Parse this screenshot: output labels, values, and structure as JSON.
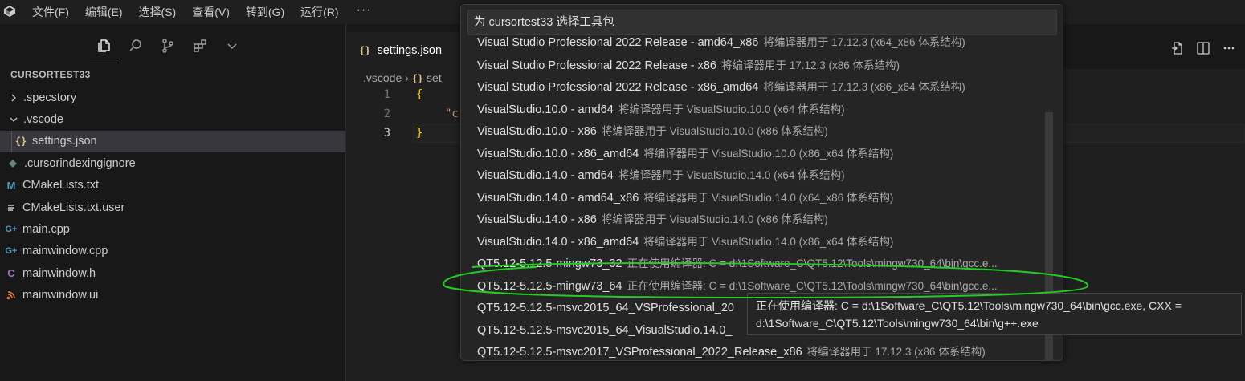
{
  "menu": {
    "items": [
      "文件(F)",
      "编辑(E)",
      "选择(S)",
      "查看(V)",
      "转到(G)",
      "运行(R)"
    ],
    "more": "···"
  },
  "sidebar": {
    "section_title": "CURSORTEST33",
    "items": [
      {
        "label": ".specstory",
        "type": "folder",
        "expanded": false
      },
      {
        "label": ".vscode",
        "type": "folder",
        "expanded": true
      },
      {
        "label": "settings.json",
        "type": "json",
        "icon_text": "{}",
        "selected": true
      },
      {
        "label": ".cursorindexingignore",
        "type": "file"
      },
      {
        "label": "CMakeLists.txt",
        "type": "cmake",
        "icon_text": "M"
      },
      {
        "label": "CMakeLists.txt.user",
        "type": "text"
      },
      {
        "label": "main.cpp",
        "type": "cpp",
        "icon_text": "G+"
      },
      {
        "label": "mainwindow.cpp",
        "type": "cpp",
        "icon_text": "G+"
      },
      {
        "label": "mainwindow.h",
        "type": "header",
        "icon_text": "C"
      },
      {
        "label": "mainwindow.ui",
        "type": "ui"
      }
    ]
  },
  "editor": {
    "tab_label": "settings.json",
    "tab_icon_text": "{}",
    "breadcrumb": {
      "folder": ".vscode",
      "sep": "›",
      "file": "set"
    },
    "lines": [
      {
        "num": "1",
        "text": "{"
      },
      {
        "num": "2",
        "text": "\"c"
      },
      {
        "num": "3",
        "text": "}"
      }
    ]
  },
  "quickpick": {
    "placeholder": "为 cursortest33 选择工具包",
    "items": [
      {
        "label": "Visual Studio Professional 2022 Release - amd64_x86",
        "desc": "将编译器用于 17.12.3 (x64_x86 体系结构)"
      },
      {
        "label": "Visual Studio Professional 2022 Release - x86",
        "desc": "将编译器用于 17.12.3 (x86 体系结构)"
      },
      {
        "label": "Visual Studio Professional 2022 Release - x86_amd64",
        "desc": "将编译器用于 17.12.3 (x86_x64 体系结构)"
      },
      {
        "label": "VisualStudio.10.0 - amd64",
        "desc": "将编译器用于 VisualStudio.10.0 (x64 体系结构)"
      },
      {
        "label": "VisualStudio.10.0 - x86",
        "desc": "将编译器用于 VisualStudio.10.0 (x86 体系结构)"
      },
      {
        "label": "VisualStudio.10.0 - x86_amd64",
        "desc": "将编译器用于 VisualStudio.10.0 (x86_x64 体系结构)"
      },
      {
        "label": "VisualStudio.14.0 - amd64",
        "desc": "将编译器用于 VisualStudio.14.0 (x64 体系结构)"
      },
      {
        "label": "VisualStudio.14.0 - amd64_x86",
        "desc": "将编译器用于 VisualStudio.14.0 (x64_x86 体系结构)"
      },
      {
        "label": "VisualStudio.14.0 - x86",
        "desc": "将编译器用于 VisualStudio.14.0 (x86 体系结构)"
      },
      {
        "label": "VisualStudio.14.0 - x86_amd64",
        "desc": "将编译器用于 VisualStudio.14.0 (x86_x64 体系结构)"
      },
      {
        "label": "QT5.12-5.12.5-mingw73_32",
        "desc": "正在使用编译器: C = d:\\1Software_C\\QT5.12\\Tools\\mingw730_64\\bin\\gcc.e..."
      },
      {
        "label": "QT5.12-5.12.5-mingw73_64",
        "desc": "正在使用编译器: C = d:\\1Software_C\\QT5.12\\Tools\\mingw730_64\\bin\\gcc.e..."
      },
      {
        "label": "QT5.12-5.12.5-msvc2015_64_VSProfessional_20",
        "desc": ""
      },
      {
        "label": "QT5.12-5.12.5-msvc2015_64_VisualStudio.14.0_",
        "desc": ""
      },
      {
        "label": "QT5.12-5.12.5-msvc2017_VSProfessional_2022_Release_x86",
        "desc": "将编译器用于 17.12.3 (x86 体系结构)"
      }
    ]
  },
  "tooltip": {
    "line1": "正在使用编译器: C = d:\\1Software_C\\QT5.12\\Tools\\mingw730_64\\bin\\gcc.exe, CXX =",
    "line2": "d:\\1Software_C\\QT5.12\\Tools\\mingw730_64\\bin\\g++.exe"
  },
  "colors": {
    "annotation": "#22cc22",
    "json_icon": "#e2c08d",
    "cmake_icon": "#519aba",
    "cpp_icon": "#519aba",
    "header_icon": "#a074c4",
    "ui_icon": "#e37933"
  }
}
